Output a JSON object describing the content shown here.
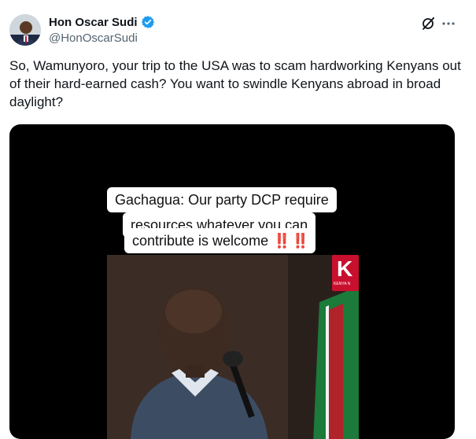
{
  "author": {
    "display_name": "Hon Oscar Sudi",
    "handle": "@HonOscarSudi",
    "verified": true,
    "verified_color": "#1d9bf0"
  },
  "tweet": {
    "text": "So, Wamunyoro, your trip to the USA was to scam hardworking Kenyans out of their hard-earned cash? You want to swindle Kenyans abroad in broad daylight?"
  },
  "media": {
    "caption_lines": [
      "Gachagua: Our party DCP require",
      "resources whatever you can",
      "contribute is welcome"
    ],
    "caption_emoji": "‼️ ‼️",
    "channel_logo_text": "K",
    "channel_logo_subtext": "KENYA N"
  },
  "icons": {
    "grok": "grok-icon",
    "more": "more-icon",
    "verified": "verified-badge-icon"
  }
}
